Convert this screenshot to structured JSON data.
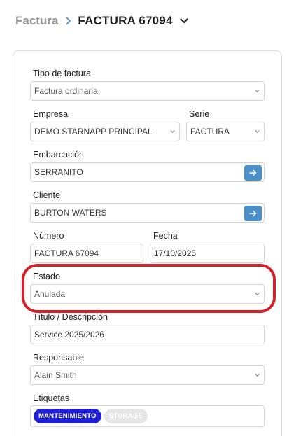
{
  "breadcrumb": {
    "parent": "Factura",
    "current": "FACTURA 67094"
  },
  "form": {
    "tipo": {
      "label": "Tipo de factura",
      "value": "Factura ordinaria"
    },
    "empresa": {
      "label": "Empresa",
      "value": "DEMO STARNAPP PRINCIPAL"
    },
    "serie": {
      "label": "Serie",
      "value": "FACTURA"
    },
    "embarcacion": {
      "label": "Embarcación",
      "value": "SERRANITO"
    },
    "cliente": {
      "label": "Cliente",
      "value": "BURTON WATERS"
    },
    "numero": {
      "label": "Número",
      "value": "FACTURA 67094"
    },
    "fecha": {
      "label": "Fecha",
      "value": "17/10/2025"
    },
    "estado": {
      "label": "Estado",
      "value": "Anulada"
    },
    "titulo": {
      "label": "Título / Descripción",
      "value": "Service 2025/2026"
    },
    "responsable": {
      "label": "Responsable",
      "value": "Alain Smith"
    },
    "etiquetas": {
      "label": "Etiquetas",
      "tags": [
        "MANTENIMIENTO",
        "STORAGE"
      ]
    }
  },
  "colors": {
    "accent": "#4a8fc8",
    "highlight": "#d4202a",
    "tag_primary": "#1f1fd6",
    "tag_secondary": "#e6e6e6"
  },
  "icons": {
    "breadcrumb_separator": "chevron-right-icon",
    "title_menu": "chevron-down-icon",
    "go": "arrow-right-icon",
    "select": "select-caret-icon"
  }
}
